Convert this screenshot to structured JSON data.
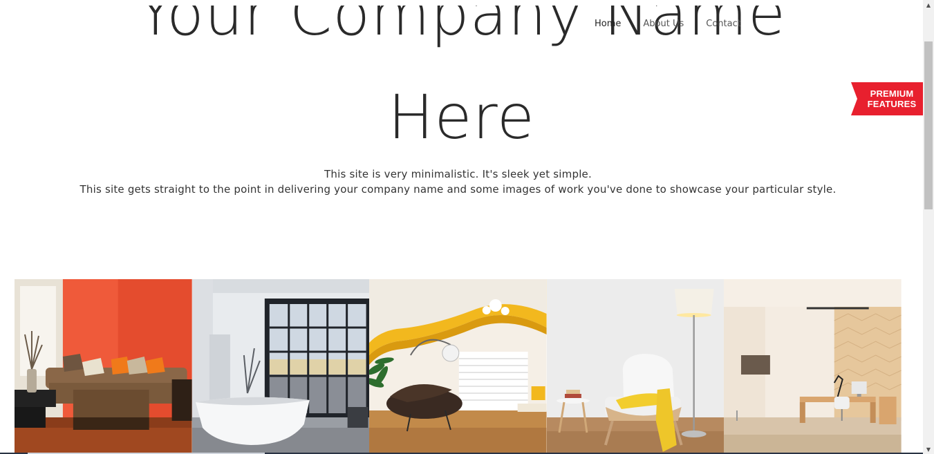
{
  "nav": {
    "items": [
      {
        "label": "Home"
      },
      {
        "label": "About Us"
      },
      {
        "label": "Contact"
      }
    ]
  },
  "hero": {
    "title_line1": "Your Company Name",
    "title_line2": "Here"
  },
  "tagline": {
    "line1": "This site is very minimalistic. It's sleek yet simple.",
    "line2": "This site gets straight to the point in delivering your company name and some images of work you've done to showcase your particular style."
  },
  "premium": {
    "line1": "PREMIUM",
    "line2": "FEATURES",
    "color": "#e8202e"
  },
  "gallery": {
    "images": [
      {
        "subject": "living-room-orange-wall"
      },
      {
        "subject": "bathroom-bathtub-window"
      },
      {
        "subject": "modern-room-yellow-ceiling"
      },
      {
        "subject": "white-armchair-floor-lamp"
      },
      {
        "subject": "office-wood-panel"
      }
    ]
  }
}
